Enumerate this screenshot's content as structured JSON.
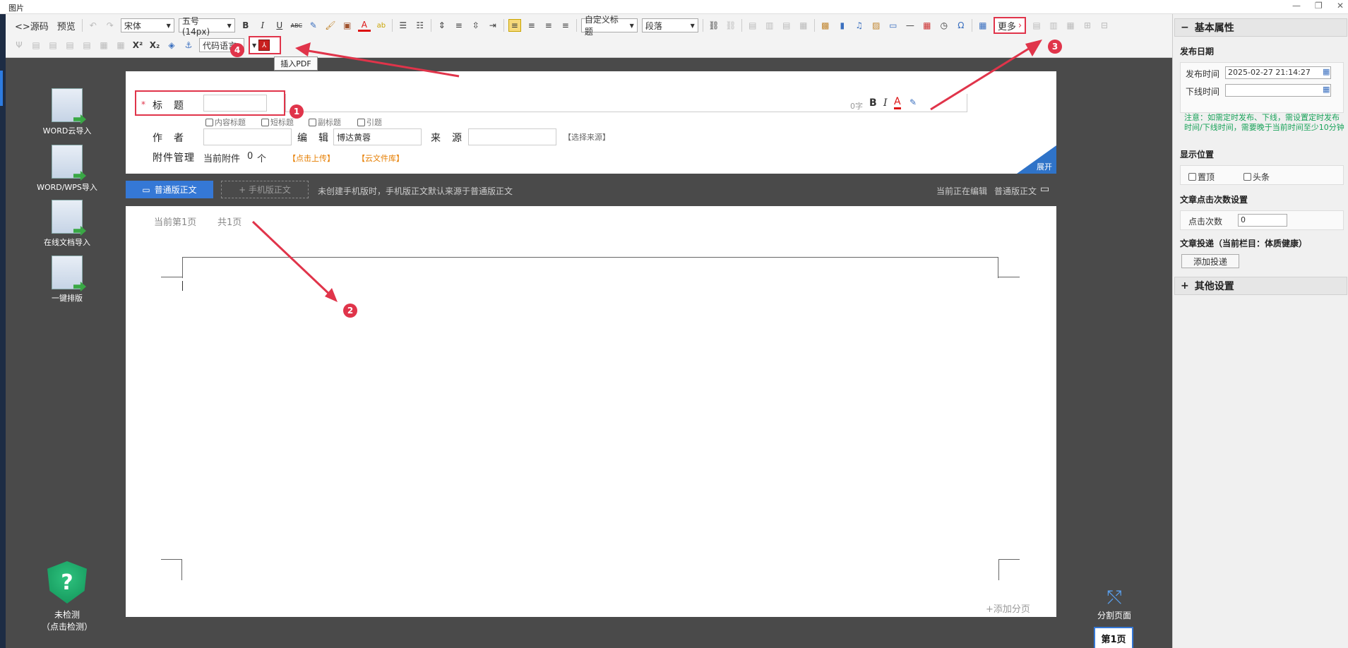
{
  "window": {
    "title": "图片",
    "controls": [
      "—",
      "❐",
      "✕"
    ]
  },
  "toolbar": {
    "source": "<>源码",
    "preview": "预览",
    "font": "宋体",
    "size": "五号(14px)",
    "custom_heading": "自定义标题",
    "paragraph": "段落",
    "code_lang": "代码语言",
    "more": "更多",
    "more_arrow": "›"
  },
  "tooltip": "插入PDF",
  "left_tools": [
    {
      "label": "WORD云导入"
    },
    {
      "label": "WORD/WPS导入"
    },
    {
      "label": "在线文档导入"
    },
    {
      "label": "一键排版"
    }
  ],
  "check": {
    "line1": "未检测",
    "line2": "（点击检测）"
  },
  "form": {
    "required_mark": "*",
    "title_label": "标　题",
    "word_count": "0字",
    "checkboxes": [
      "内容标题",
      "短标题",
      "副标题",
      "引题"
    ],
    "author_label": "作　者",
    "editor_label": "编　辑",
    "editor_value": "博达黄蓉",
    "source_label": "来　源",
    "select_source": "【选择来源】",
    "attach_label": "附件管理",
    "current_attach": "当前附件",
    "attach_count": "0",
    "attach_unit": "个",
    "upload": "【点击上传】",
    "cloud_lib": "【云文件库】",
    "expand": "展开",
    "fmt": [
      "B",
      "I",
      "A"
    ]
  },
  "tabs": {
    "normal": "普通版正文",
    "mobile": "+ 手机版正文",
    "hint": "未创建手机版时，手机版正文默认来源于普通版正文",
    "editing": "当前正在编辑",
    "editing_target": "普通版正文"
  },
  "page": {
    "current": "当前第1页",
    "total": "共1页",
    "add_page": "+添加分页",
    "split": "分割页面",
    "page1": "第1页"
  },
  "right_panel": {
    "basic_title": "基本属性",
    "publish_date": "发布日期",
    "publish_time_label": "发布时间",
    "publish_time_value": "2025-02-27 21:14:27",
    "offline_time_label": "下线时间",
    "note": "注意：如需定时发布、下线，需设置定时发布时间/下线时间，需要晚于当前时间至少10分钟",
    "display_pos": "显示位置",
    "top_pin": "置顶",
    "headline": "头条",
    "click_settings": "文章点击次数设置",
    "click_count_label": "点击次数",
    "click_count_value": "0",
    "submission": "文章投递（当前栏目：体质健康）",
    "add_submission": "添加投递",
    "other_settings": "其他设置"
  },
  "badges": [
    "1",
    "2",
    "3",
    "4"
  ],
  "colors": {
    "accent": "#3578d6",
    "highlight": "#e0344a",
    "note": "#1aa35a",
    "link": "#e67e00"
  }
}
